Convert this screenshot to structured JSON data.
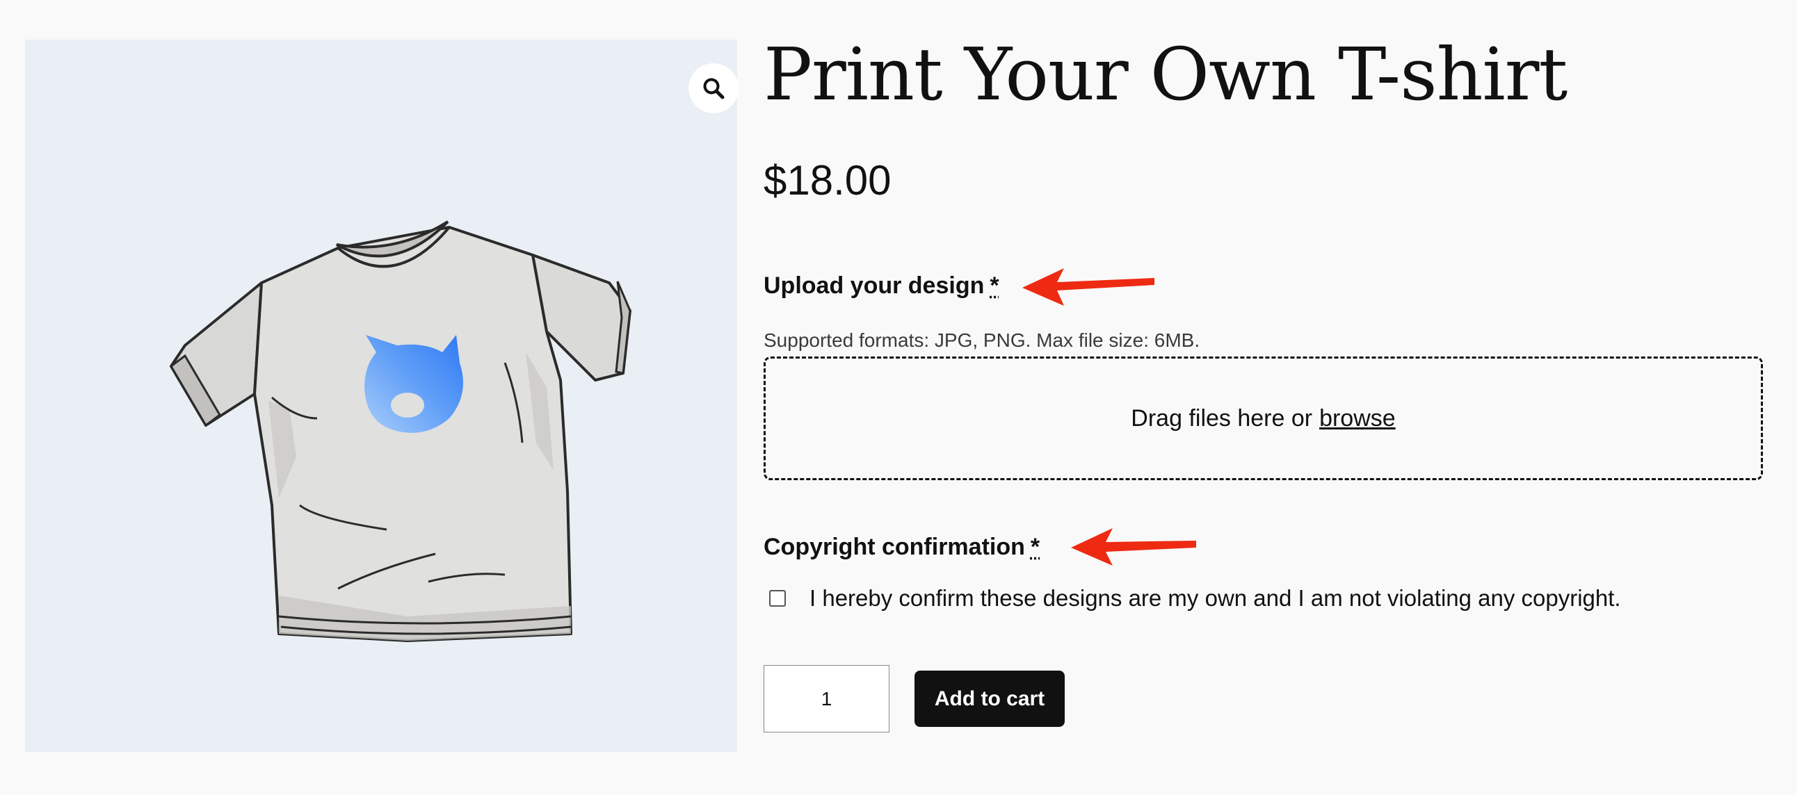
{
  "product": {
    "title": "Print Your Own T-shirt",
    "price": "$18.00",
    "image_icon": "t-shirt-with-blue-cat-head-print",
    "print_color": "#3b82f6"
  },
  "gallery": {
    "zoom_icon": "magnifier-icon"
  },
  "upload": {
    "label": "Upload your design",
    "required_mark": "*",
    "hint": "Supported formats: JPG, PNG. Max file size: 6MB.",
    "dropzone_text": "Drag files here or",
    "browse_label": "browse"
  },
  "copyright": {
    "label": "Copyright confirmation",
    "required_mark": "*",
    "checkbox_label": "I hereby confirm these designs are my own and I am not violating any copyright.",
    "checked": false
  },
  "cart": {
    "quantity": "1",
    "add_to_cart_label": "Add to cart"
  },
  "annotations": {
    "arrow_color": "#ee2a12"
  }
}
